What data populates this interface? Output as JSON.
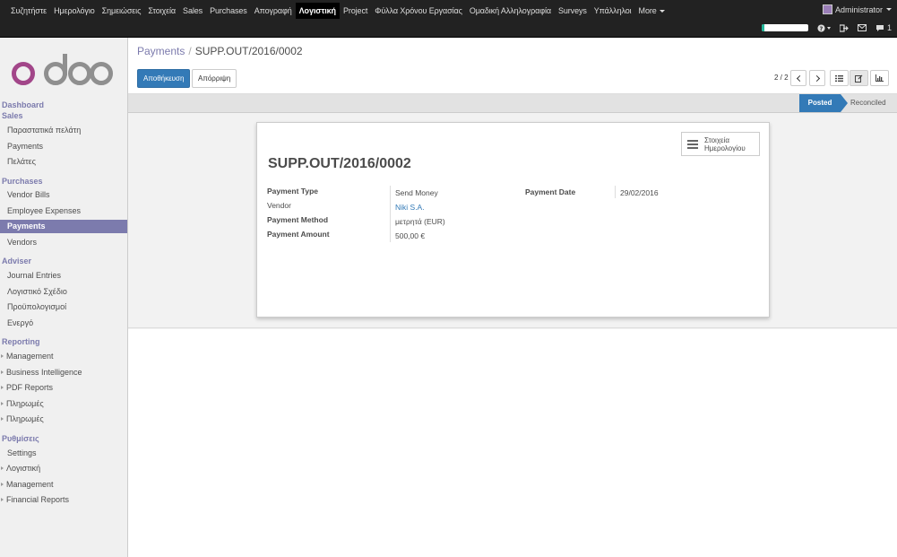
{
  "topmenu": {
    "items": [
      "Συζητήστε",
      "Ημερολόγιο",
      "Σημειώσεις",
      "Στοιχεία",
      "Sales",
      "Purchases",
      "Απογραφή",
      "Λογιστική",
      "Project",
      "Φύλλα Χρόνου Εργασίας",
      "Ομαδική Αλληλογραφία",
      "Surveys",
      "Υπάλληλοι",
      "More"
    ],
    "active": "Λογιστική",
    "user": "Administrator",
    "chat_count": "1",
    "progress": 0.05
  },
  "sidebar": {
    "sections": [
      {
        "label": "Dashboard",
        "items": []
      },
      {
        "label": "Sales",
        "items": [
          "Παραστατικά πελάτη",
          "Payments",
          "Πελάτες"
        ]
      },
      {
        "label": "Purchases",
        "items": [
          "Vendor Bills",
          "Employee Expenses",
          "Payments",
          "Vendors"
        ]
      },
      {
        "label": "Adviser",
        "items": [
          "Journal Entries",
          "Λογιστικό Σχέδιο",
          "Προϋπολογισμοί",
          "Ενεργό"
        ]
      },
      {
        "label": "Reporting",
        "items": [
          "Management",
          "Business Intelligence",
          "PDF Reports",
          "Πληρωμές",
          "Πληρωμές"
        ]
      },
      {
        "label": "Ρυθμίσεις",
        "items": [
          "Settings",
          "Λογιστική",
          "Management",
          "Financial Reports"
        ]
      }
    ],
    "active_item": "Payments"
  },
  "breadcrumb": {
    "parent": "Payments",
    "separator": "/",
    "current": "SUPP.OUT/2016/0002"
  },
  "buttons": {
    "save": "Αποθήκευση",
    "discard": "Απόρριψη"
  },
  "pager": {
    "value": "2 / 2"
  },
  "status": {
    "posted": "Posted",
    "reconciled": "Reconciled"
  },
  "record": {
    "journal_button": [
      "Στοιχεία",
      "Ημερολογίου"
    ],
    "title": "SUPP.OUT/2016/0002",
    "fields": {
      "payment_type_label": "Payment Type",
      "payment_type": "Send Money",
      "vendor_label": "Vendor",
      "vendor": "Niki S.A.",
      "payment_method_label": "Payment Method",
      "payment_method": "μετρητά (EUR)",
      "payment_amount_label": "Payment Amount",
      "payment_amount": "500,00 €",
      "payment_date_label": "Payment Date",
      "payment_date": "29/02/2016"
    }
  }
}
